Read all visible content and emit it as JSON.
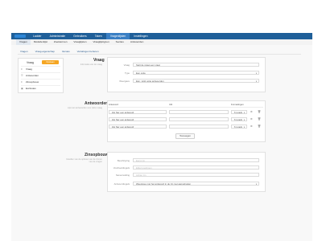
{
  "topnav": {
    "items": [
      "Ladder",
      "Administratie",
      "Gebruikers",
      "Taken",
      "Vragenlijsten",
      "Instellingen"
    ],
    "active_index": 4
  },
  "subnav": {
    "items": [
      "Vragen",
      "Modellenlijst",
      "Zoektermen",
      "Vraaglijsten",
      "Vraaglijsttypen",
      "Secties",
      "Antwoorden"
    ],
    "active_index": 0
  },
  "tabs": [
    "Vragen",
    "Vraag-eigenschap",
    "Versies",
    "Vertalingen beheren"
  ],
  "sidebar": {
    "title": "Vraag",
    "button_label": "Opslaan",
    "items": [
      {
        "icon": "≡",
        "label": "Vraag"
      },
      {
        "icon": "☰",
        "label": "Antwoorden"
      },
      {
        "icon": "≡",
        "label": "Zinsopbouw"
      },
      {
        "icon": "▣",
        "label": "Exclusies"
      }
    ]
  },
  "vraag_section": {
    "title": "Vraag",
    "description": "Informatie van de vraag",
    "fields": [
      {
        "label": "Vraag",
        "value": "Stelt de vraag een vraat"
      },
      {
        "label": "Type",
        "value": "Een optie"
      },
      {
        "label": "Weergave",
        "value": "Eén, vinkt optie antwoorden"
      }
    ]
  },
  "antwoorden_section": {
    "title": "Antwoorden",
    "description": "Lijst van antwoorden voor deze vraag",
    "columns": [
      "Antwoord",
      "Uitl",
      "Formatingen"
    ],
    "rows": [
      {
        "antwoord": "Zet hier een antwoord",
        "uitl": "",
        "format": "6 regels"
      },
      {
        "antwoord": "Zet hier een antwoord",
        "uitl": "",
        "format": "6 regels"
      },
      {
        "antwoord": "Zet hier een antwoord",
        "uitl": "",
        "format": "6 regels"
      }
    ],
    "add_button": "Toevoegen"
  },
  "zinsopbouw_section": {
    "title": "Zinsopbouw",
    "description": "Instellen van de opbouw van de zinnen van de vragen",
    "fields": [
      {
        "label": "Beschrijving",
        "placeholder": "Eerst zin"
      },
      {
        "label": "Voorbeeldregels",
        "placeholder": "Elderregelingen"
      },
      {
        "label": "Samenvatting",
        "placeholder": "Achter zin"
      },
      {
        "label": "Antwoordregels",
        "value": "Weergave met het antwoord in de zin met aangeboden"
      }
    ]
  },
  "colors": {
    "topbar": "#1f5f99",
    "accent": "#f5a623",
    "link": "#2a5a8c"
  }
}
